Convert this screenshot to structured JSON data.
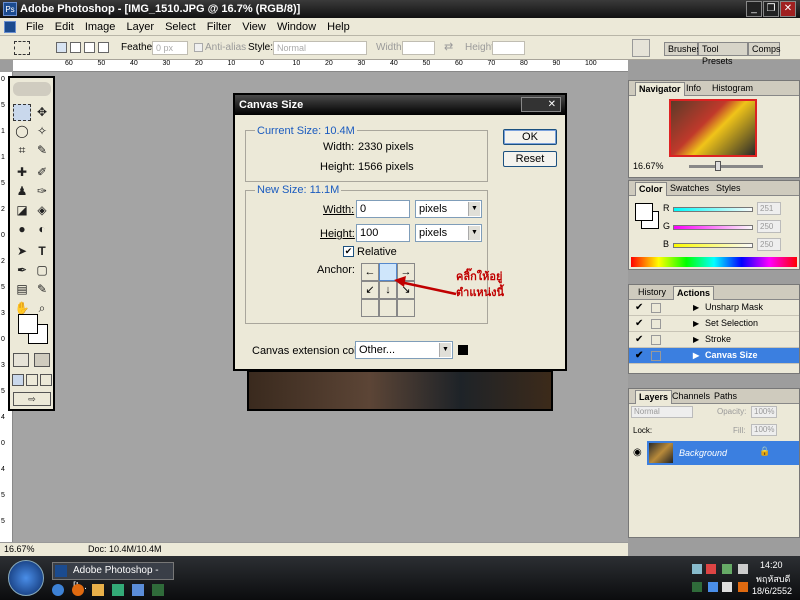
{
  "window": {
    "title": "Adobe Photoshop - [IMG_1510.JPG @ 16.7% (RGB/8)]",
    "logo": "Ps",
    "min": "_",
    "max": "❐",
    "close": "✕"
  },
  "menu": [
    "File",
    "Edit",
    "Image",
    "Layer",
    "Select",
    "Filter",
    "View",
    "Window",
    "Help"
  ],
  "options": {
    "feather_label": "Feather:",
    "feather_value": "0 px",
    "antialias": "Anti-alias",
    "style_label": "Style:",
    "style_value": "Normal",
    "width_label": "Width:",
    "height_label": "Height:",
    "swap": "⇄"
  },
  "palette_well": [
    "Brushes",
    "Tool Presets",
    "Comps"
  ],
  "ruler": {
    "h": [
      "60",
      "50",
      "40",
      "30",
      "20",
      "10",
      "0",
      "10",
      "20",
      "30",
      "40",
      "50",
      "60",
      "70",
      "80",
      "90",
      "100"
    ],
    "v": [
      "0",
      "5",
      "1",
      "1",
      "5",
      "2",
      "0",
      "2",
      "5",
      "3",
      "0",
      "3",
      "5",
      "4",
      "0",
      "4",
      "5",
      "5"
    ]
  },
  "dialog": {
    "title": "Canvas Size",
    "current_title": "Current Size: 10.4M",
    "current_width_label": "Width:",
    "current_width": "2330 pixels",
    "current_height_label": "Height:",
    "current_height": "1566 pixels",
    "new_title": "New Size: 11.1M",
    "width_label": "Width:",
    "width_value": "0",
    "width_unit": "pixels",
    "height_label": "Height:",
    "height_value": "100",
    "height_unit": "pixels",
    "relative_label": "Relative",
    "anchor_label": "Anchor:",
    "ext_label": "Canvas extension color:",
    "ext_value": "Other...",
    "ok": "OK",
    "cancel": "Reset",
    "close_glyph": "✕"
  },
  "annotation": {
    "line1": "คลิ๊กให้อยู่",
    "line2": "ตำแหน่งนี้",
    "color": "#c00000"
  },
  "navigator": {
    "tabs": [
      "Navigator",
      "Info",
      "Histogram"
    ],
    "zoom": "16.67%"
  },
  "color_panel": {
    "tabs": [
      "Color",
      "Swatches",
      "Styles"
    ],
    "r_label": "R",
    "g_label": "G",
    "b_label": "B",
    "r": "251",
    "g": "250",
    "b": "250"
  },
  "actions_panel": {
    "tabs": [
      "History",
      "Actions"
    ],
    "items": [
      "Unsharp Mask",
      "Set Selection",
      "Stroke",
      "Canvas Size"
    ]
  },
  "layers_panel": {
    "tabs": [
      "Layers",
      "Channels",
      "Paths"
    ],
    "blend": "Normal",
    "opacity_label": "Opacity:",
    "opacity": "100%",
    "lock_label": "Lock:",
    "fill_label": "Fill:",
    "fill": "100%",
    "layer_name": "Background"
  },
  "status": {
    "zoom": "16.67%",
    "doc": "Doc: 10.4M/10.4M"
  },
  "taskbar": {
    "task_label": "Adobe Photoshop - [I...",
    "time": "14:20",
    "day": "พฤหัสบดี",
    "date": "18/6/2552"
  }
}
